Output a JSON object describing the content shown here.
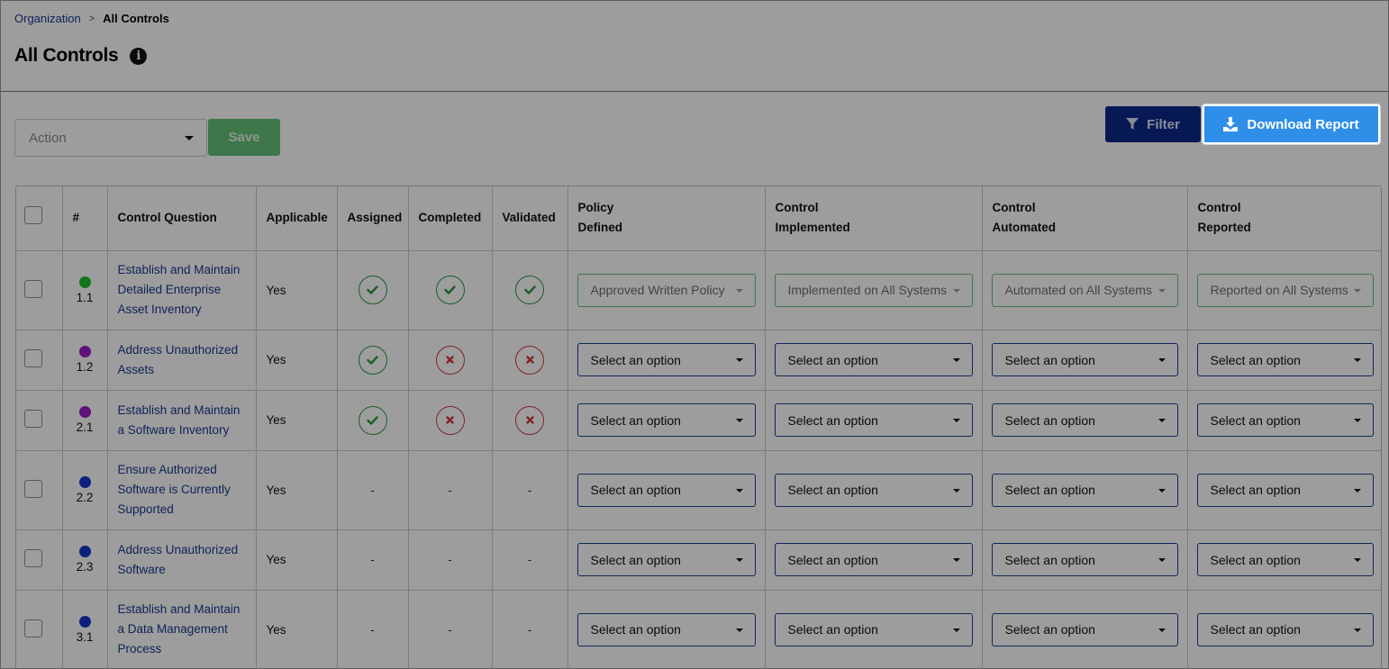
{
  "breadcrumb": {
    "parent": "Organization",
    "separator": ">",
    "current": "All Controls"
  },
  "page": {
    "title": "All Controls",
    "info_icon": "i"
  },
  "toolbar": {
    "action_placeholder": "Action",
    "save_label": "Save",
    "filter_label": "Filter",
    "download_label": "Download Report"
  },
  "table": {
    "headers": {
      "number": "#",
      "question": "Control Question",
      "applicable": "Applicable",
      "assigned": "Assigned",
      "completed": "Completed",
      "validated": "Validated",
      "policy_1": "Policy",
      "policy_2": "Defined",
      "implemented_1": "Control",
      "implemented_2": "Implemented",
      "automated_1": "Control",
      "automated_2": "Automated",
      "reported_1": "Control",
      "reported_2": "Reported"
    },
    "rows": [
      {
        "id": "1.1",
        "dot_color": "#1fbf2e",
        "q1": "Establish and Maintain",
        "q2": "Detailed Enterprise",
        "q3": "Asset Inventory",
        "applicable": "Yes",
        "assigned": "ok",
        "completed": "ok",
        "validated": "ok",
        "policy": "Approved Written Policy",
        "implemented": "Implemented on All Systems",
        "automated": "Automated on All Systems",
        "reported": "Reported on All Systems",
        "filled": true
      },
      {
        "id": "1.2",
        "dot_color": "#9b1cc2",
        "q1": "Address Unauthorized",
        "q2": "Assets",
        "q3": "",
        "applicable": "Yes",
        "assigned": "ok",
        "completed": "no",
        "validated": "no",
        "policy": "Select an option",
        "implemented": "Select an option",
        "automated": "Select an option",
        "reported": "Select an option",
        "filled": false
      },
      {
        "id": "2.1",
        "dot_color": "#9b1cc2",
        "q1": "Establish and Maintain",
        "q2": "a Software Inventory",
        "q3": "",
        "applicable": "Yes",
        "assigned": "ok",
        "completed": "no",
        "validated": "no",
        "policy": "Select an option",
        "implemented": "Select an option",
        "automated": "Select an option",
        "reported": "Select an option",
        "filled": false
      },
      {
        "id": "2.2",
        "dot_color": "#1237c9",
        "q1": "Ensure Authorized",
        "q2": "Software is Currently",
        "q3": "Supported",
        "applicable": "Yes",
        "assigned": "-",
        "completed": "-",
        "validated": "-",
        "policy": "Select an option",
        "implemented": "Select an option",
        "automated": "Select an option",
        "reported": "Select an option",
        "filled": false
      },
      {
        "id": "2.3",
        "dot_color": "#1237c9",
        "q1": "Address Unauthorized",
        "q2": "Software",
        "q3": "",
        "applicable": "Yes",
        "assigned": "-",
        "completed": "-",
        "validated": "-",
        "policy": "Select an option",
        "implemented": "Select an option",
        "automated": "Select an option",
        "reported": "Select an option",
        "filled": false
      },
      {
        "id": "3.1",
        "dot_color": "#1237c9",
        "q1": "Establish and Maintain",
        "q2": "a Data Management",
        "q3": "Process",
        "applicable": "Yes",
        "assigned": "-",
        "completed": "-",
        "validated": "-",
        "policy": "Select an option",
        "implemented": "Select an option",
        "automated": "Select an option",
        "reported": "Select an option",
        "filled": false
      }
    ]
  },
  "colors": {
    "link": "#1a3a8f",
    "save": "#66c278",
    "filter": "#0c2a8a",
    "download": "#2f8ee8",
    "ok": "#2b9a3c",
    "no": "#d6383c"
  }
}
